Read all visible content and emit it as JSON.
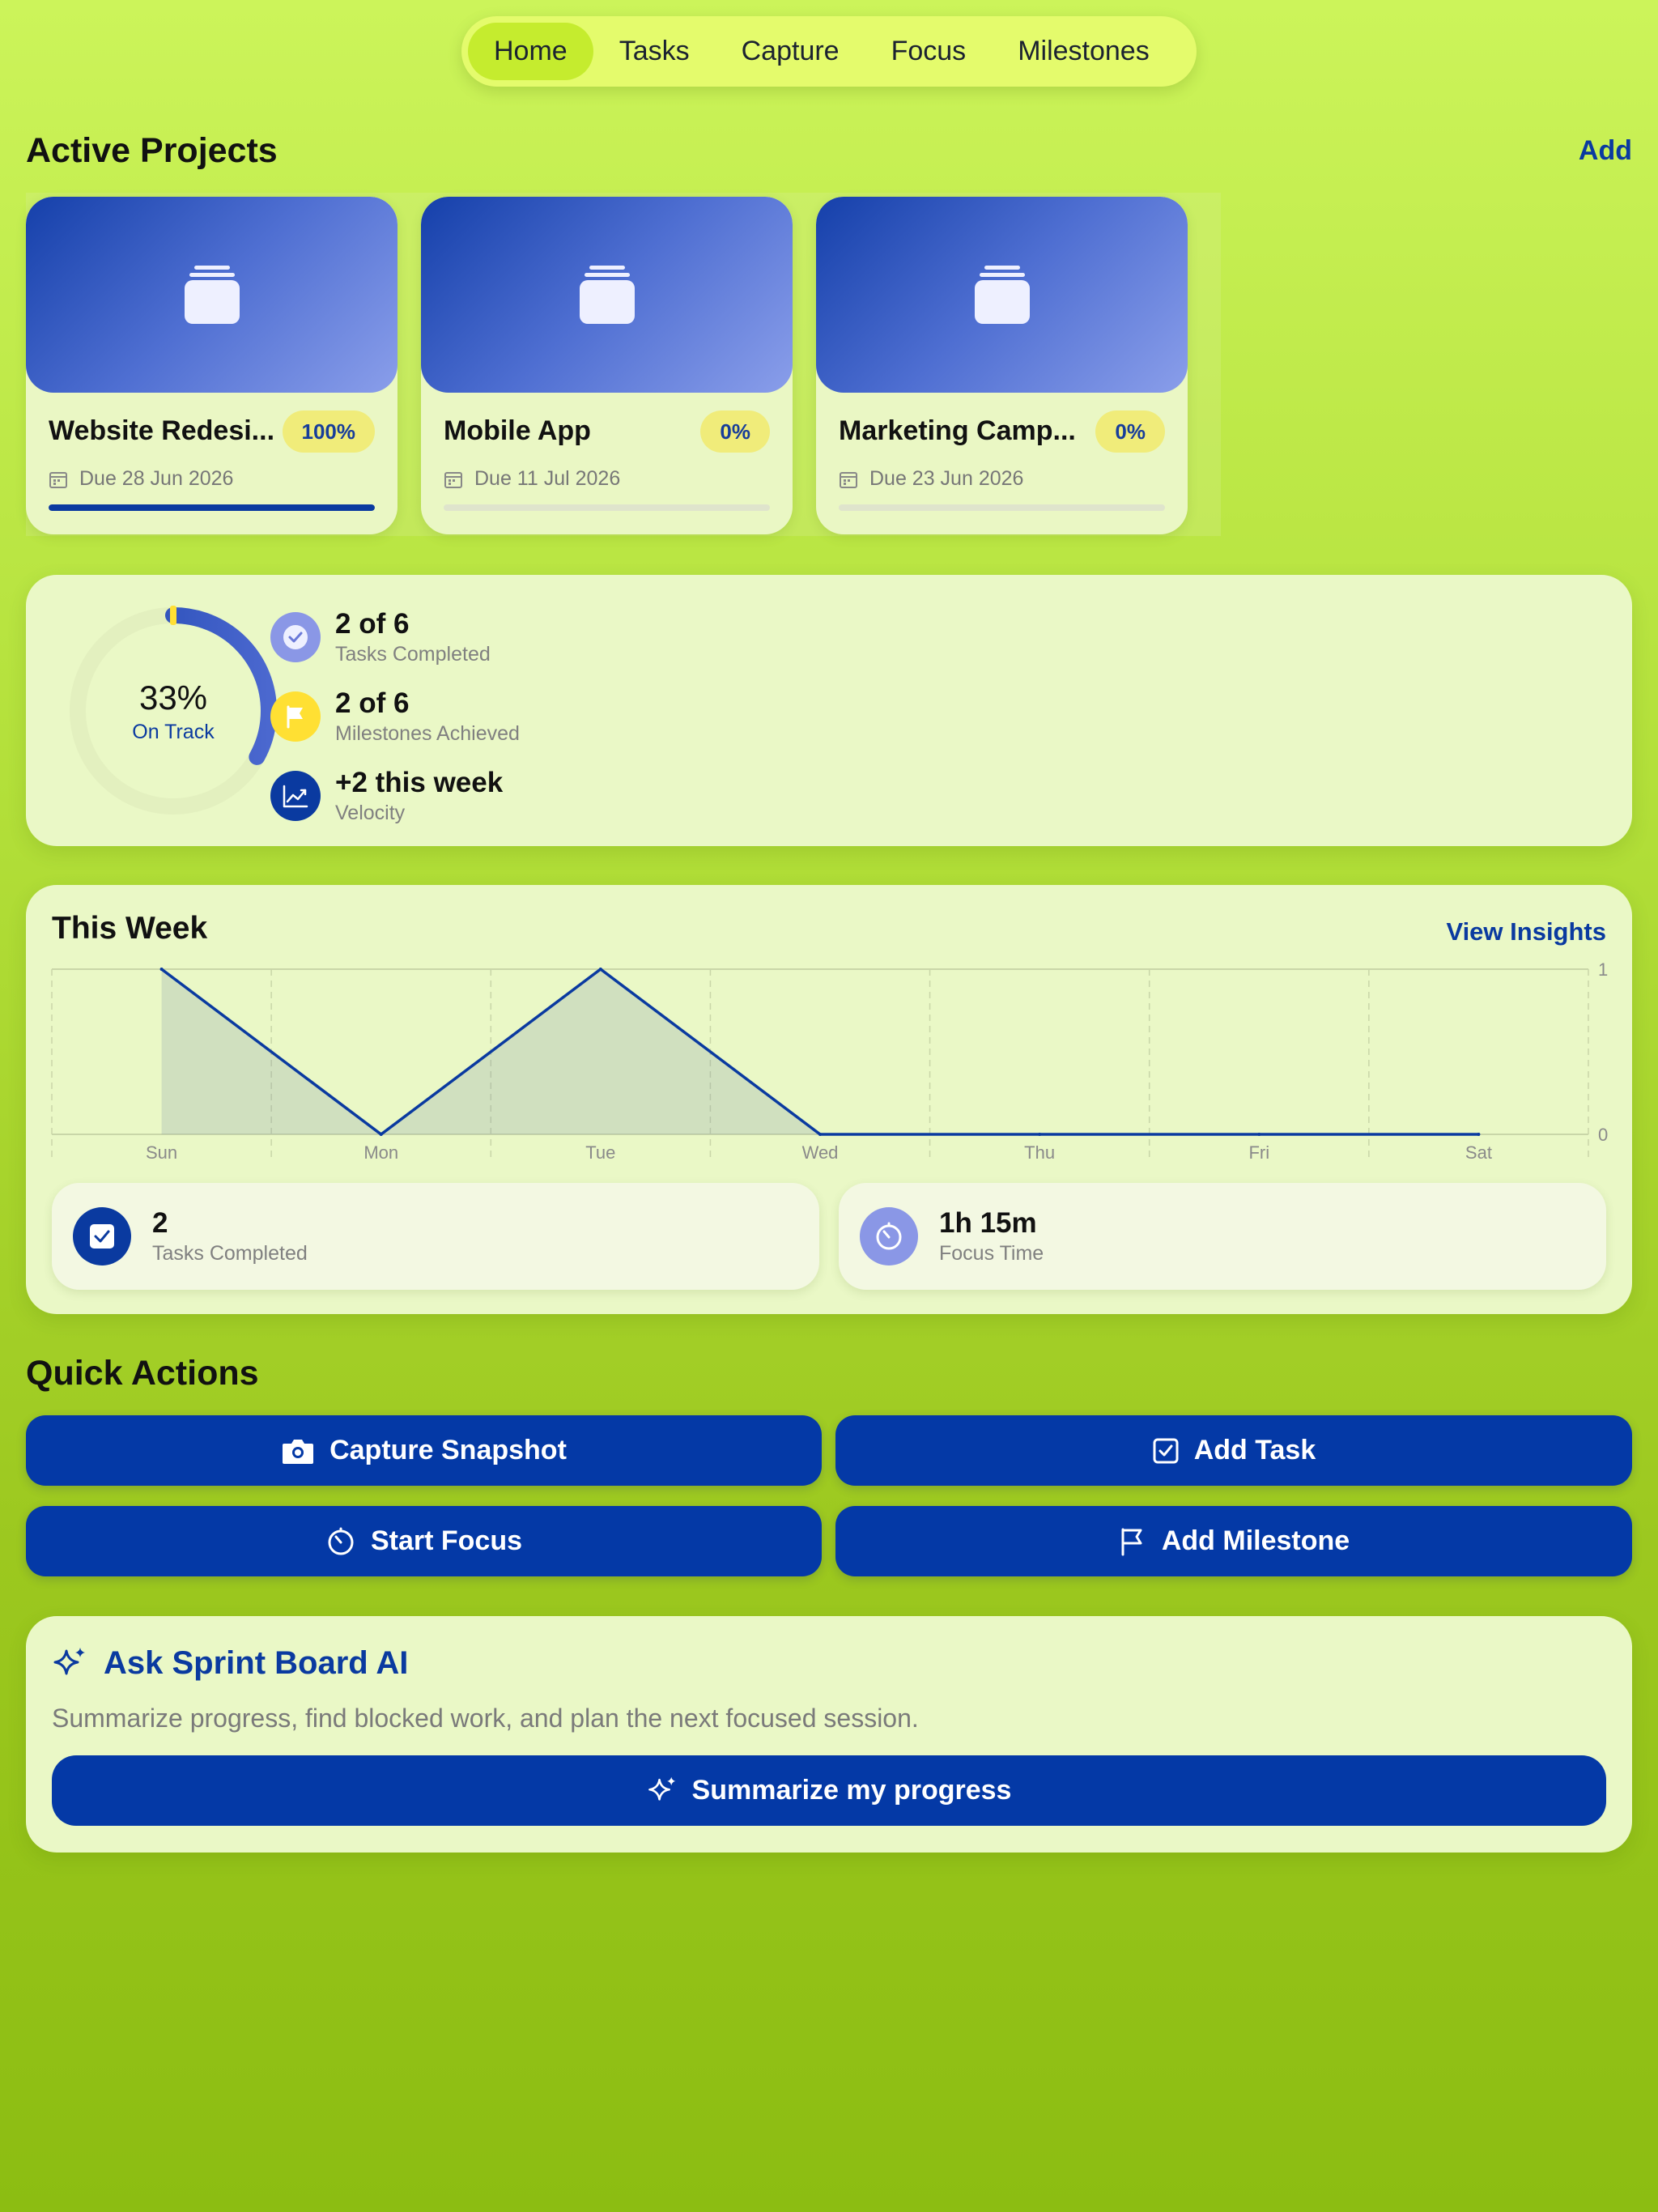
{
  "nav": {
    "tabs": [
      {
        "label": "Home",
        "active": true
      },
      {
        "label": "Tasks",
        "active": false
      },
      {
        "label": "Capture",
        "active": false
      },
      {
        "label": "Focus",
        "active": false
      },
      {
        "label": "Milestones",
        "active": false
      }
    ]
  },
  "projects": {
    "title": "Active Projects",
    "add_label": "Add",
    "items": [
      {
        "name": "Website Redesi...",
        "percent_label": "100%",
        "progress": 1.0,
        "due": "Due 28 Jun 2026"
      },
      {
        "name": "Mobile App",
        "percent_label": "0%",
        "progress": 0.0,
        "due": "Due 11 Jul 2026"
      },
      {
        "name": "Marketing Camp...",
        "percent_label": "0%",
        "progress": 0.0,
        "due": "Due 23 Jun 2026"
      }
    ]
  },
  "stats": {
    "ring_percent_label": "33%",
    "ring_progress": 0.33,
    "ring_status": "On Track",
    "rows": [
      {
        "value": "2 of 6",
        "label": "Tasks Completed",
        "icon": "check-circle-icon"
      },
      {
        "value": "2 of 6",
        "label": "Milestones Achieved",
        "icon": "flag-icon"
      },
      {
        "value": "+2 this week",
        "label": "Velocity",
        "icon": "trend-up-icon"
      }
    ]
  },
  "week": {
    "title": "This Week",
    "insights_label": "View Insights",
    "summary": [
      {
        "value": "2",
        "label": "Tasks Completed",
        "icon": "checkbox-icon"
      },
      {
        "value": "1h 15m",
        "label": "Focus Time",
        "icon": "timer-icon"
      }
    ]
  },
  "chart_data": {
    "type": "area",
    "categories": [
      "Sun",
      "Mon",
      "Tue",
      "Wed",
      "Thu",
      "Fri",
      "Sat"
    ],
    "values": [
      1,
      0,
      1,
      0,
      0,
      0,
      0
    ],
    "ylim": [
      0,
      1
    ],
    "y_ticks": [
      "0",
      "1"
    ],
    "grid": true
  },
  "quick_actions": {
    "title": "Quick Actions",
    "buttons": [
      {
        "label": "Capture Snapshot",
        "icon": "camera-icon"
      },
      {
        "label": "Add Task",
        "icon": "checkbox-icon"
      },
      {
        "label": "Start Focus",
        "icon": "timer-icon"
      },
      {
        "label": "Add Milestone",
        "icon": "flag-icon"
      }
    ]
  },
  "ai": {
    "title": "Ask Sprint Board AI",
    "description": "Summarize progress, find blocked work, and plan the next focused session.",
    "button_label": "Summarize my progress"
  },
  "colors": {
    "accent": "#0439a6",
    "badge": "#f0ec7a",
    "lavender": "#8a97e6",
    "yellow": "#ffe033"
  }
}
